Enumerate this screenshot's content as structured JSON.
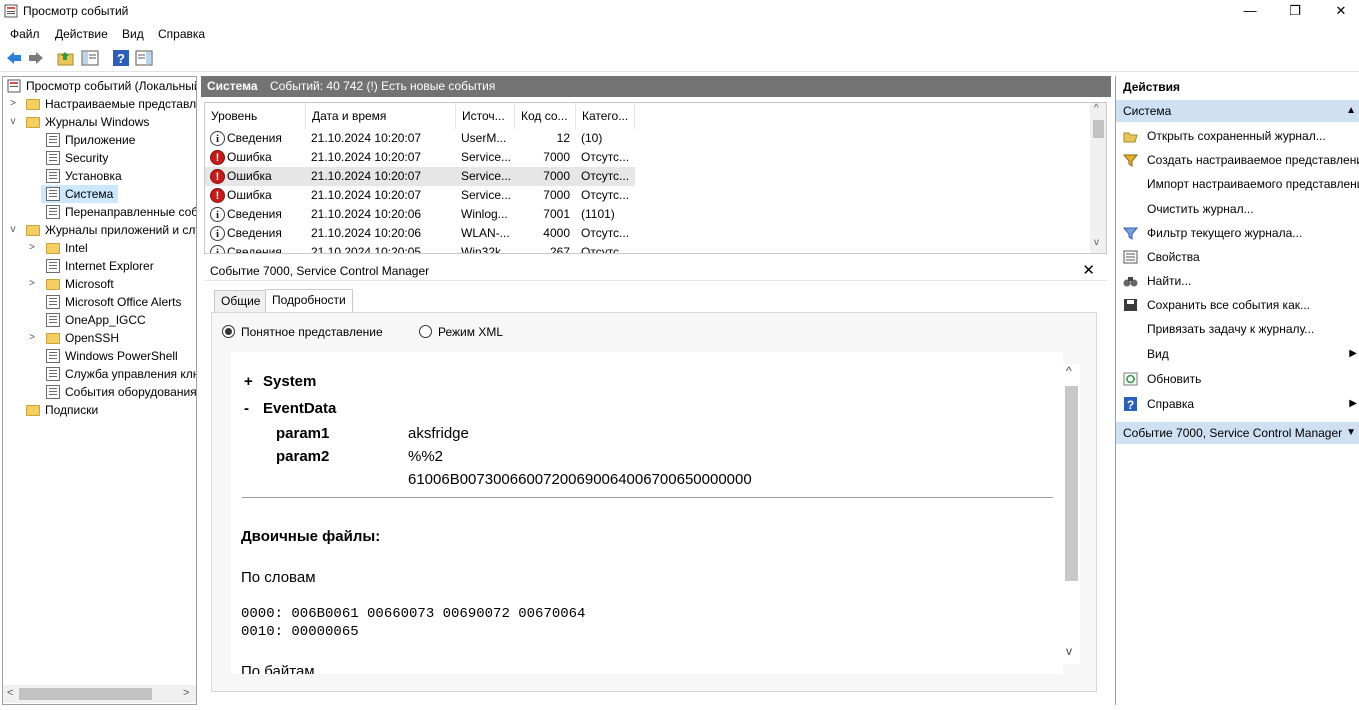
{
  "window": {
    "title": "Просмотр событий",
    "minimize": "—",
    "restore": "❐",
    "close": "✕"
  },
  "menu": [
    "Файл",
    "Действие",
    "Вид",
    "Справка"
  ],
  "tree": {
    "root": "Просмотр событий (Локальный)",
    "custom_views": "Настраиваемые представления",
    "windows_logs": "Журналы Windows",
    "wl_items": [
      "Приложение",
      "Security",
      "Установка",
      "Система",
      "Перенаправленные события"
    ],
    "app_logs": "Журналы приложений и служб",
    "al_items": [
      "Intel",
      "Internet Explorer",
      "Microsoft",
      "Microsoft Office Alerts",
      "OneApp_IGCC",
      "OpenSSH",
      "Windows PowerShell",
      "Служба управления ключами",
      "События оборудования"
    ],
    "subscriptions": "Подписки"
  },
  "center": {
    "log_name": "Система",
    "summary": "Событий: 40 742 (!) Есть новые события"
  },
  "grid": {
    "columns": [
      "Уровень",
      "Дата и время",
      "Источ...",
      "Код со...",
      "Катего..."
    ],
    "rows": [
      {
        "level": "Сведения",
        "type": "info",
        "date": "21.10.2024 10:20:07",
        "source": "UserM...",
        "code": "12",
        "cat": "(10)"
      },
      {
        "level": "Ошибка",
        "type": "error",
        "date": "21.10.2024 10:20:07",
        "source": "Service...",
        "code": "7000",
        "cat": "Отсутс..."
      },
      {
        "level": "Ошибка",
        "type": "error",
        "date": "21.10.2024 10:20:07",
        "source": "Service...",
        "code": "7000",
        "cat": "Отсутс..."
      },
      {
        "level": "Ошибка",
        "type": "error",
        "date": "21.10.2024 10:20:07",
        "source": "Service...",
        "code": "7000",
        "cat": "Отсутс..."
      },
      {
        "level": "Сведения",
        "type": "info",
        "date": "21.10.2024 10:20:06",
        "source": "Winlog...",
        "code": "7001",
        "cat": "(1101)"
      },
      {
        "level": "Сведения",
        "type": "info",
        "date": "21.10.2024 10:20:06",
        "source": "WLAN-...",
        "code": "4000",
        "cat": "Отсутс..."
      },
      {
        "level": "Сведения",
        "type": "info",
        "date": "21.10.2024 10:20:05",
        "source": "Win32k",
        "code": "267",
        "cat": "Отсутс..."
      }
    ]
  },
  "detail": {
    "title": "Событие 7000, Service Control Manager",
    "close": "✕",
    "tabs": [
      "Общие",
      "Подробности"
    ],
    "radio_friendly": "Понятное представление",
    "radio_xml": "Режим XML",
    "system": "System",
    "eventdata": "EventData",
    "plus": "+",
    "minus": "-",
    "param1_name": "param1",
    "param1_value": "aksfridge",
    "param2_name": "param2",
    "param2_value": "%%2",
    "param2_value2": "61006B00730066007200690064006700650000000",
    "binary_title": "Двоичные файлы:",
    "by_words": "По словам",
    "hex1": "0000: 006B0061 00660073 00690072 00670064",
    "hex2": "0010: 00000065",
    "by_bytes": "По байтам"
  },
  "actions": {
    "title": "Действия",
    "section1": "Система",
    "items": [
      {
        "label": "Открыть сохраненный журнал...",
        "icon": "open-folder-icon"
      },
      {
        "label": "Создать настраиваемое представление...",
        "icon": "filter-create-icon"
      },
      {
        "label": "Импорт настраиваемого представления...",
        "icon": ""
      },
      {
        "label": "Очистить журнал...",
        "icon": ""
      },
      {
        "label": "Фильтр текущего журнала...",
        "icon": "filter-icon"
      },
      {
        "label": "Свойства",
        "icon": "properties-icon"
      },
      {
        "label": "Найти...",
        "icon": "binoculars-icon"
      },
      {
        "label": "Сохранить все события как...",
        "icon": "save-icon"
      },
      {
        "label": "Привязать задачу к журналу...",
        "icon": ""
      },
      {
        "label": "Вид",
        "icon": ""
      },
      {
        "label": "Обновить",
        "icon": "refresh-icon"
      },
      {
        "label": "Справка",
        "icon": "help-icon"
      }
    ],
    "section2": "Событие 7000, Service Control Manager"
  },
  "colors": {
    "header_gray": "#737373",
    "selection": "#cce8ff",
    "actions_section": "#cfe0f3",
    "error": "#c41b1b"
  }
}
